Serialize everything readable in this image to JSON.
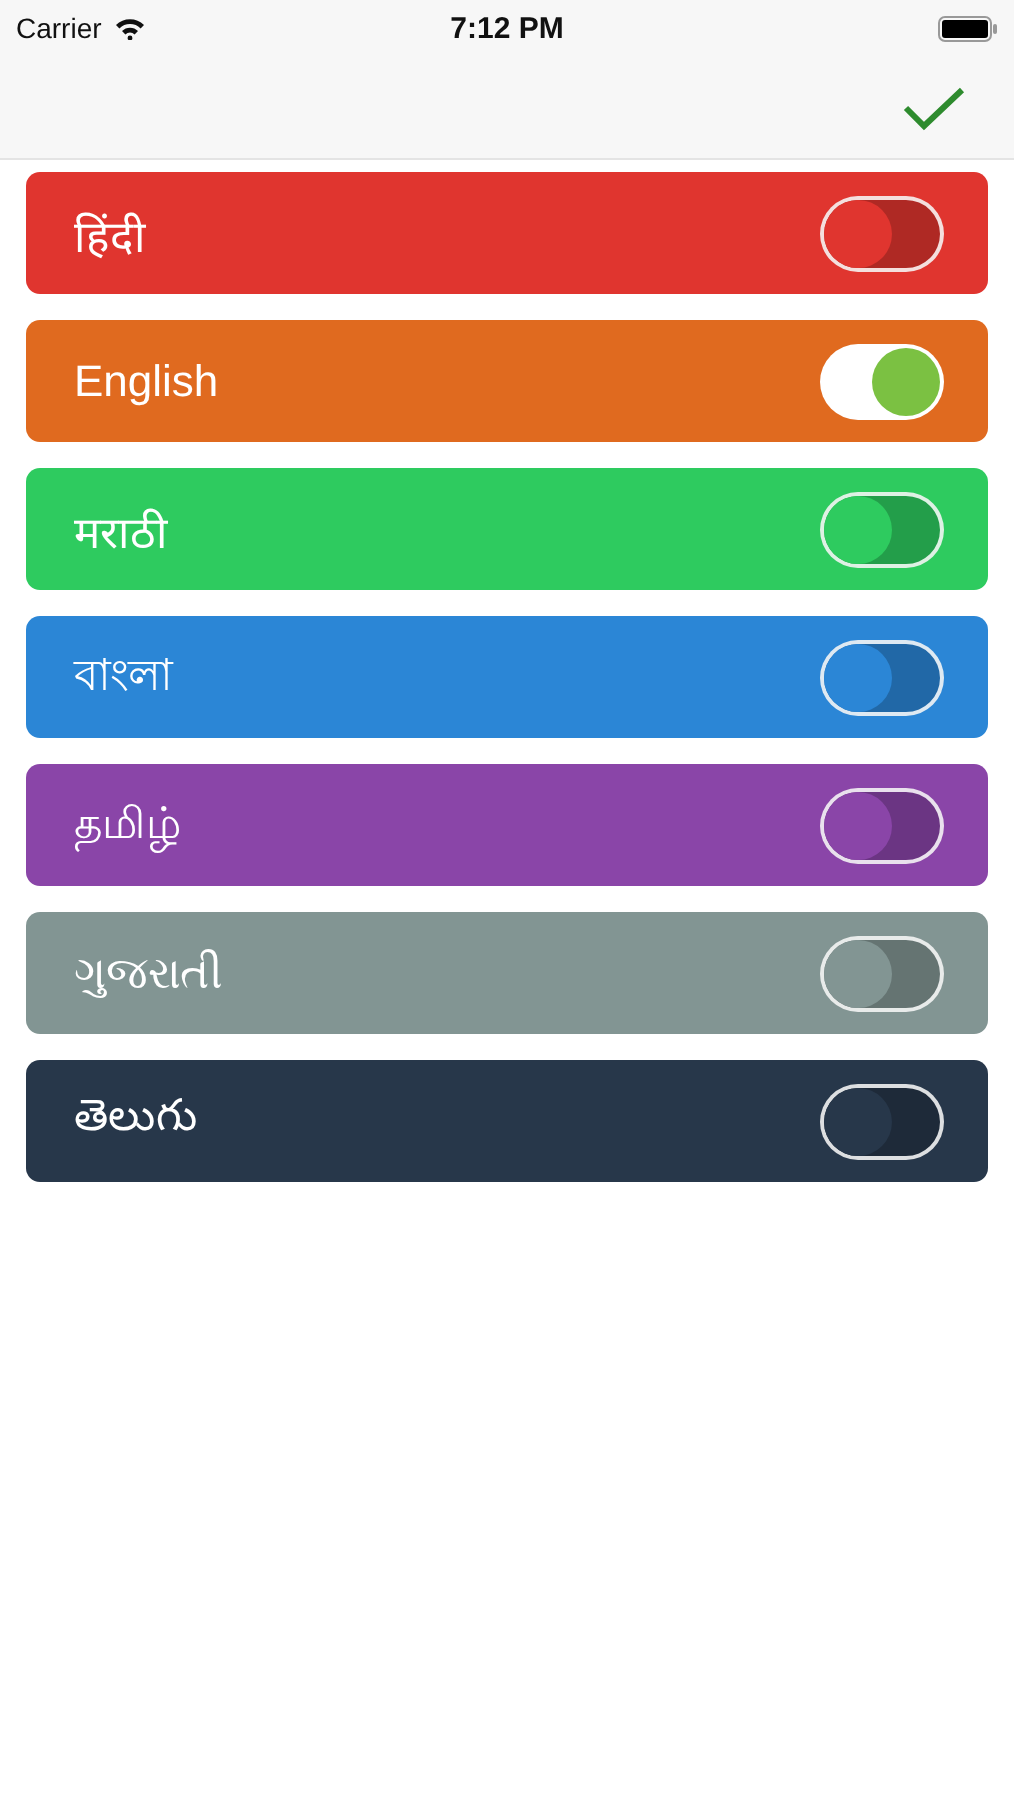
{
  "status_bar": {
    "carrier": "Carrier",
    "time": "7:12 PM"
  },
  "languages": [
    {
      "name": "हिंदी",
      "color": "#e0352f",
      "on": false
    },
    {
      "name": "English",
      "color": "#e06a1f",
      "on": true
    },
    {
      "name": "मराठी",
      "color": "#2ecb5f",
      "on": false
    },
    {
      "name": "বাংলা",
      "color": "#2b86d6",
      "on": false
    },
    {
      "name": "தமிழ்",
      "color": "#8a45a8",
      "on": false
    },
    {
      "name": "ગુજરાતી",
      "color": "#829593",
      "on": false
    },
    {
      "name": "తెలుగు",
      "color": "#27374a",
      "on": false
    }
  ]
}
